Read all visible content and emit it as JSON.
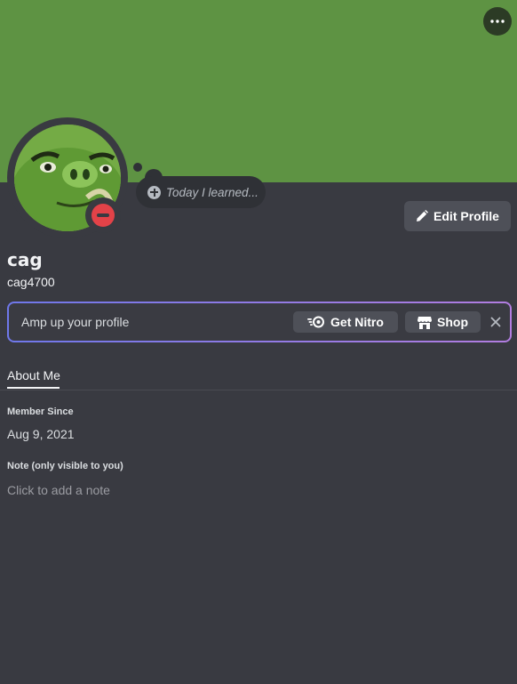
{
  "colors": {
    "banner": "#5e9343",
    "background": "#393a41",
    "status_dnd": "#e34248",
    "button": "#4e5058",
    "nitro_gradient_start": "#6f78ea",
    "nitro_gradient_end": "#b27de0"
  },
  "header": {
    "more_icon": "ellipsis-icon",
    "custom_status_placeholder": "Today I learned...",
    "edit_profile_label": "Edit Profile",
    "edit_profile_icon": "pencil-icon"
  },
  "profile": {
    "display_name": "cag",
    "username": "cag4700",
    "avatar_icon": "green-pig-avatar",
    "status": "do-not-disturb"
  },
  "nitro_banner": {
    "text": "Amp up your profile",
    "get_nitro_label": "Get Nitro",
    "get_nitro_icon": "nitro-icon",
    "shop_label": "Shop",
    "shop_icon": "shop-icon",
    "dismiss_icon": "close-icon"
  },
  "tabs": [
    {
      "label": "About Me",
      "active": true
    }
  ],
  "about": {
    "member_since_label": "Member Since",
    "member_since_value": "Aug 9, 2021",
    "note_label": "Note (only visible to you)",
    "note_placeholder": "Click to add a note"
  }
}
